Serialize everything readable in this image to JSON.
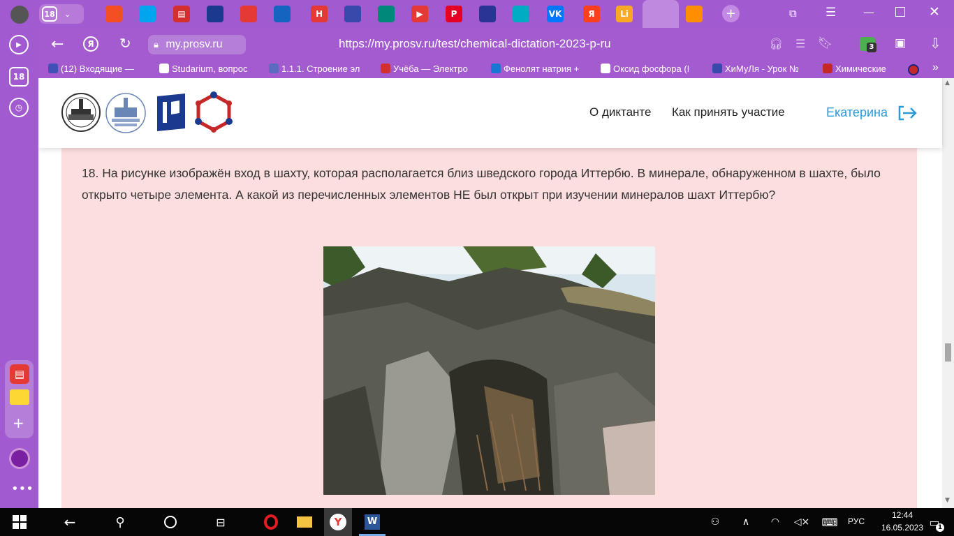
{
  "tabs": {
    "tab_count": "18",
    "favicons": [
      {
        "name": "windows-tiles-icon",
        "color": "#f25022"
      },
      {
        "name": "microsoft-icon",
        "color": "#00a4ef"
      },
      {
        "name": "docs-icon",
        "color": "#d32f2f",
        "glyph": "▤"
      },
      {
        "name": "prosv-icon",
        "color": "#1a3a8f"
      },
      {
        "name": "tab-icon-5",
        "color": "#e53935"
      },
      {
        "name": "tab-icon-6",
        "color": "#1565c0"
      },
      {
        "name": "tab-icon-7",
        "color": "#e53935",
        "glyph": "H"
      },
      {
        "name": "tab-icon-8",
        "color": "#3949ab"
      },
      {
        "name": "tab-icon-9",
        "color": "#00897b"
      },
      {
        "name": "tab-icon-10",
        "color": "#e53935",
        "glyph": "▶"
      },
      {
        "name": "pinterest-icon",
        "color": "#e60023",
        "glyph": "P"
      },
      {
        "name": "tab-icon-12",
        "color": "#283593"
      },
      {
        "name": "tab-icon-13",
        "color": "#00acc1"
      },
      {
        "name": "vk-icon",
        "color": "#0077ff",
        "glyph": "VK"
      },
      {
        "name": "yandex-icon",
        "color": "#fc3f1d",
        "glyph": "Я"
      },
      {
        "name": "tab-icon-16",
        "color": "#f9a825",
        "glyph": "Li"
      },
      {
        "name": "active-tab-prosv-icon",
        "color": "#1a3a8f"
      },
      {
        "name": "tab-icon-18",
        "color": "#ff8f00"
      }
    ]
  },
  "address": {
    "domain": "my.prosv.ru",
    "url": "https://my.prosv.ru/test/chemical-dictation-2023-p-ru",
    "extensions_badge": "3"
  },
  "bookmarks": [
    {
      "label": "(12) Входящие — ",
      "color": "#3f51b5"
    },
    {
      "label": "Studarium, вопрос",
      "color": "#ffffff"
    },
    {
      "label": "1.1.1. Строение эл",
      "color": "#5c6bc0"
    },
    {
      "label": "Учёба — Электро",
      "color": "#d32f2f"
    },
    {
      "label": "Фенолят натрия +",
      "color": "#1976d2"
    },
    {
      "label": "Оксид фосфора (I",
      "color": "#ffffff"
    },
    {
      "label": "ХиМуЛя - Урок №",
      "color": "#3949ab"
    },
    {
      "label": "Химические",
      "color": "#c62828"
    }
  ],
  "sidebar": {
    "badge": "18"
  },
  "site": {
    "nav_about": "О диктанте",
    "nav_participate": "Как принять участие",
    "user_name": "Екатерина"
  },
  "question": {
    "text": "18. На рисунке изображён вход в шахту, которая располагается близ шведского города Иттербю. В минерале, обнаруженном в шахте, было открыто четыре элемента. А какой из перечисленных элементов НЕ был открыт при изучении минералов шахт Иттербю?"
  },
  "taskbar": {
    "lang": "РУС",
    "time": "12:44",
    "date": "16.05.2023",
    "notifications": "1"
  },
  "colors": {
    "browser_purple": "#a55bd0",
    "accent_blue": "#2b9bd8",
    "content_pink": "#fddede"
  }
}
